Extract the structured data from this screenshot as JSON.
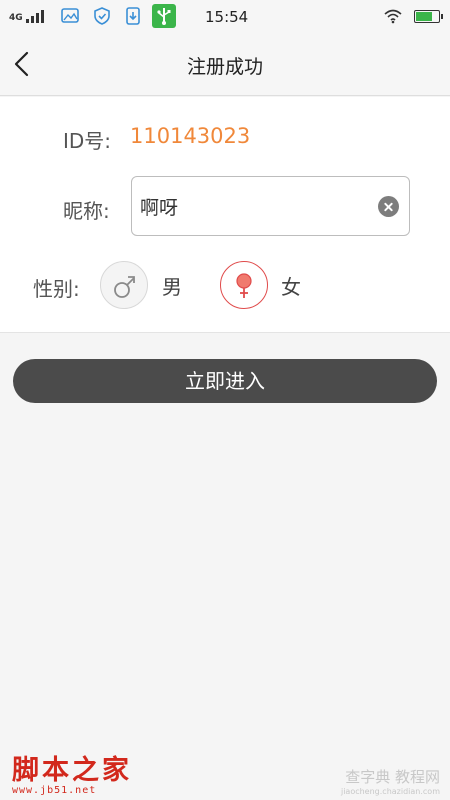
{
  "status_bar": {
    "network": "4G",
    "time": "15:54",
    "battery_level": 0.75
  },
  "header": {
    "title": "注册成功"
  },
  "form": {
    "id_label": "ID号:",
    "id_value": "110143023",
    "nickname_label": "昵称:",
    "nickname_value": "啊呀",
    "gender_label": "性别:",
    "gender_options": [
      {
        "label": "男",
        "icon": "male-icon",
        "selected": false
      },
      {
        "label": "女",
        "icon": "female-icon",
        "selected": true
      }
    ]
  },
  "enter_button": {
    "label": "立即进入"
  },
  "watermarks": {
    "left_title": "脚本之家",
    "left_url": "www.jb51.net",
    "right_title": "查字典 教程网",
    "right_url": "jiaocheng.chazidian.com"
  },
  "colors": {
    "accent": "#f0883a",
    "female": "#e04b4b",
    "button": "#4b4b4b"
  }
}
